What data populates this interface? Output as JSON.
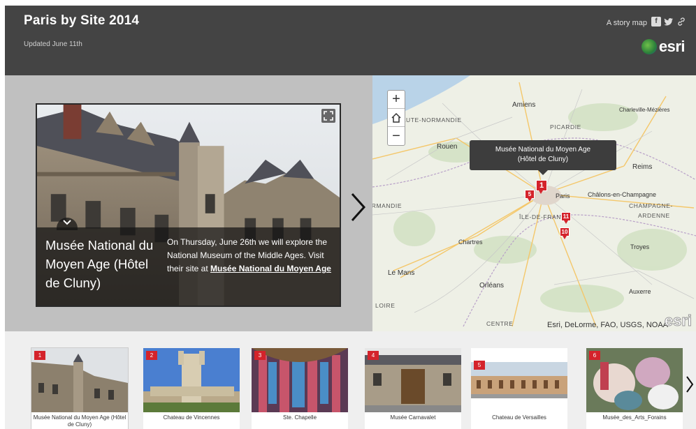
{
  "header": {
    "title": "Paris by Site 2014",
    "subtitle": "Updated June 11th",
    "story_map_link": "A story map",
    "social": {
      "facebook": "f",
      "twitter": "t",
      "link": "⛓"
    },
    "logo_text": "esri"
  },
  "main": {
    "site_name": "Musée National du Moyen Age (Hôtel de Cluny)",
    "description_prefix": "On Thursday, June 26th we will explore the National Museum of the Middle Ages. Visit their site at ",
    "description_link": "Musée National du Moyen Age"
  },
  "map": {
    "tooltip_line1": "Musée National du Moyen Age",
    "tooltip_line2": "(Hôtel de Cluny)",
    "labels": {
      "haute_normandie": "HAUTE-NORMANDIE",
      "picardie": "PICARDIE",
      "rouen": "Rouen",
      "amiens": "Amiens",
      "charleville": "Charleville-Mézières",
      "reims": "Reims",
      "chalons": "Châlons-en-Champagne",
      "champagne": "CHAMPAGNE-",
      "ardenne": "ARDENNE",
      "ile_de_france": "ÎLE-DE-FRANCE",
      "basse_normandie": "BASSE-NORMANDIE",
      "paris": "Paris",
      "chartres": "Chartres",
      "le_mans": "Le Mans",
      "orleans": "Orléans",
      "troyes": "Troyes",
      "auxerre": "Auxerre",
      "loire": "LOIRE",
      "centre": "CENTRE"
    },
    "pins": [
      "1",
      "5",
      "11",
      "10"
    ],
    "attribution": "Esri, DeLorme, FAO, USGS, NOAA",
    "watermark": "esri"
  },
  "carousel": {
    "items": [
      {
        "num": "1",
        "label": "Musée National du Moyen Age (Hôtel de Cluny)"
      },
      {
        "num": "2",
        "label": "Chateau de Vincennes"
      },
      {
        "num": "3",
        "label": "Ste. Chapelle"
      },
      {
        "num": "4",
        "label": "Musée Carnavalet"
      },
      {
        "num": "5",
        "label": "Chateau de Versailles"
      },
      {
        "num": "6",
        "label": "Musée_des_Arts_Forains"
      }
    ]
  },
  "colors": {
    "header_bg": "#444444",
    "pin_red": "#d4232b",
    "panel_bg": "#c0c0c0"
  },
  "icons": {
    "expand": "expand-icon",
    "collapse": "chevron-down-icon",
    "next": "chevron-right-icon",
    "zoom_in": "plus-icon",
    "home": "home-icon",
    "zoom_out": "minus-icon"
  }
}
